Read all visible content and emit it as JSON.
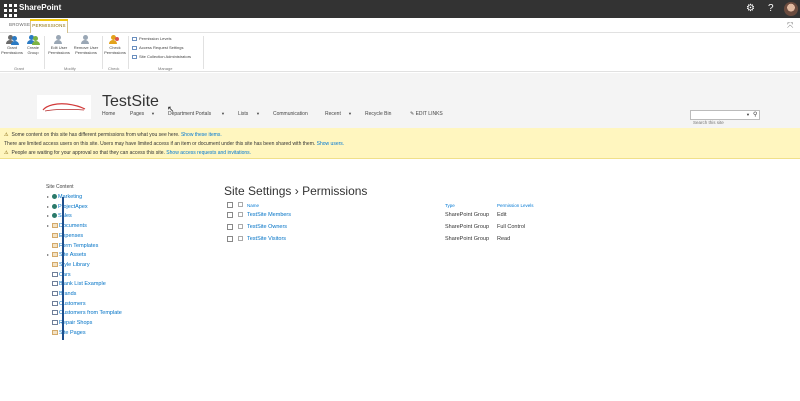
{
  "suite": {
    "title": "SharePoint",
    "settings_icon": "gear-icon",
    "help_icon": "question-icon"
  },
  "ribbon": {
    "tabs": [
      "BROWSE",
      "PERMISSIONS"
    ],
    "active_tab": "PERMISSIONS",
    "buttons": {
      "grant": "Grant Permissions",
      "create_group": "Create Group",
      "edit_user": "Edit User Permissions",
      "remove_user": "Remove User Permissions",
      "check": "Check Permissions"
    },
    "small_buttons": [
      "Permission Levels",
      "Access Request Settings",
      "Site Collection Administrators"
    ],
    "groups": [
      "Grant",
      "Modify",
      "Check",
      "Manage"
    ]
  },
  "site": {
    "title": "TestSite",
    "nav": [
      "Home",
      "Pages",
      "Department Portals",
      "Lists",
      "Communication",
      "Recent",
      "Recycle Bin"
    ],
    "edit_links": "EDIT LINKS",
    "search_placeholder": "Search this site"
  },
  "banner": {
    "msg1": "Some content on this site has different permissions from what you see here.",
    "msg1_link": "Show these items.",
    "msg2": "There are limited access users on this site. Users may have limited access if an item or document under this site has been shared with them.",
    "msg2_link": "Show users.",
    "msg3": "People are waiting for your approval so that they can access this site.",
    "msg3_link": "Show access requests and invitations."
  },
  "leftnav": {
    "title": "Site Content",
    "items": [
      {
        "label": "Marketing",
        "icon": "subsite-icon",
        "expandable": true
      },
      {
        "label": "ProjectApex",
        "icon": "subsite-icon",
        "expandable": true
      },
      {
        "label": "Sales",
        "icon": "subsite-icon",
        "expandable": true
      },
      {
        "label": "Documents",
        "icon": "library-icon",
        "expandable": true
      },
      {
        "label": "Expenses",
        "icon": "library-icon",
        "expandable": false
      },
      {
        "label": "Form Templates",
        "icon": "library-icon",
        "expandable": false
      },
      {
        "label": "Site Assets",
        "icon": "library-icon",
        "expandable": true
      },
      {
        "label": "Style Library",
        "icon": "library-icon",
        "expandable": false
      },
      {
        "label": "Cars",
        "icon": "list-icon",
        "expandable": false
      },
      {
        "label": "Blank List Example",
        "icon": "list-icon",
        "expandable": false
      },
      {
        "label": "Brands",
        "icon": "list-icon",
        "expandable": false
      },
      {
        "label": "Customers",
        "icon": "list-icon",
        "expandable": false
      },
      {
        "label": "Customers from Template",
        "icon": "list-icon",
        "expandable": false
      },
      {
        "label": "Repair Shops",
        "icon": "list-icon",
        "expandable": false
      },
      {
        "label": "Site Pages",
        "icon": "library-icon",
        "expandable": false
      }
    ]
  },
  "main": {
    "title": "Site Settings",
    "title_sep": "›",
    "subtitle": "Permissions",
    "columns": {
      "name": "Name",
      "type": "Type",
      "levels": "Permission Levels"
    },
    "rows": [
      {
        "name": "TestSite Members",
        "type": "SharePoint Group",
        "levels": "Edit"
      },
      {
        "name": "TestSite Owners",
        "type": "SharePoint Group",
        "levels": "Full Control"
      },
      {
        "name": "TestSite Visitors",
        "type": "SharePoint Group",
        "levels": "Read"
      }
    ]
  },
  "colors": {
    "suitebar": "#333333",
    "accent": "#0078d4",
    "banner": "#fff6bf",
    "link": "#0072c6"
  }
}
